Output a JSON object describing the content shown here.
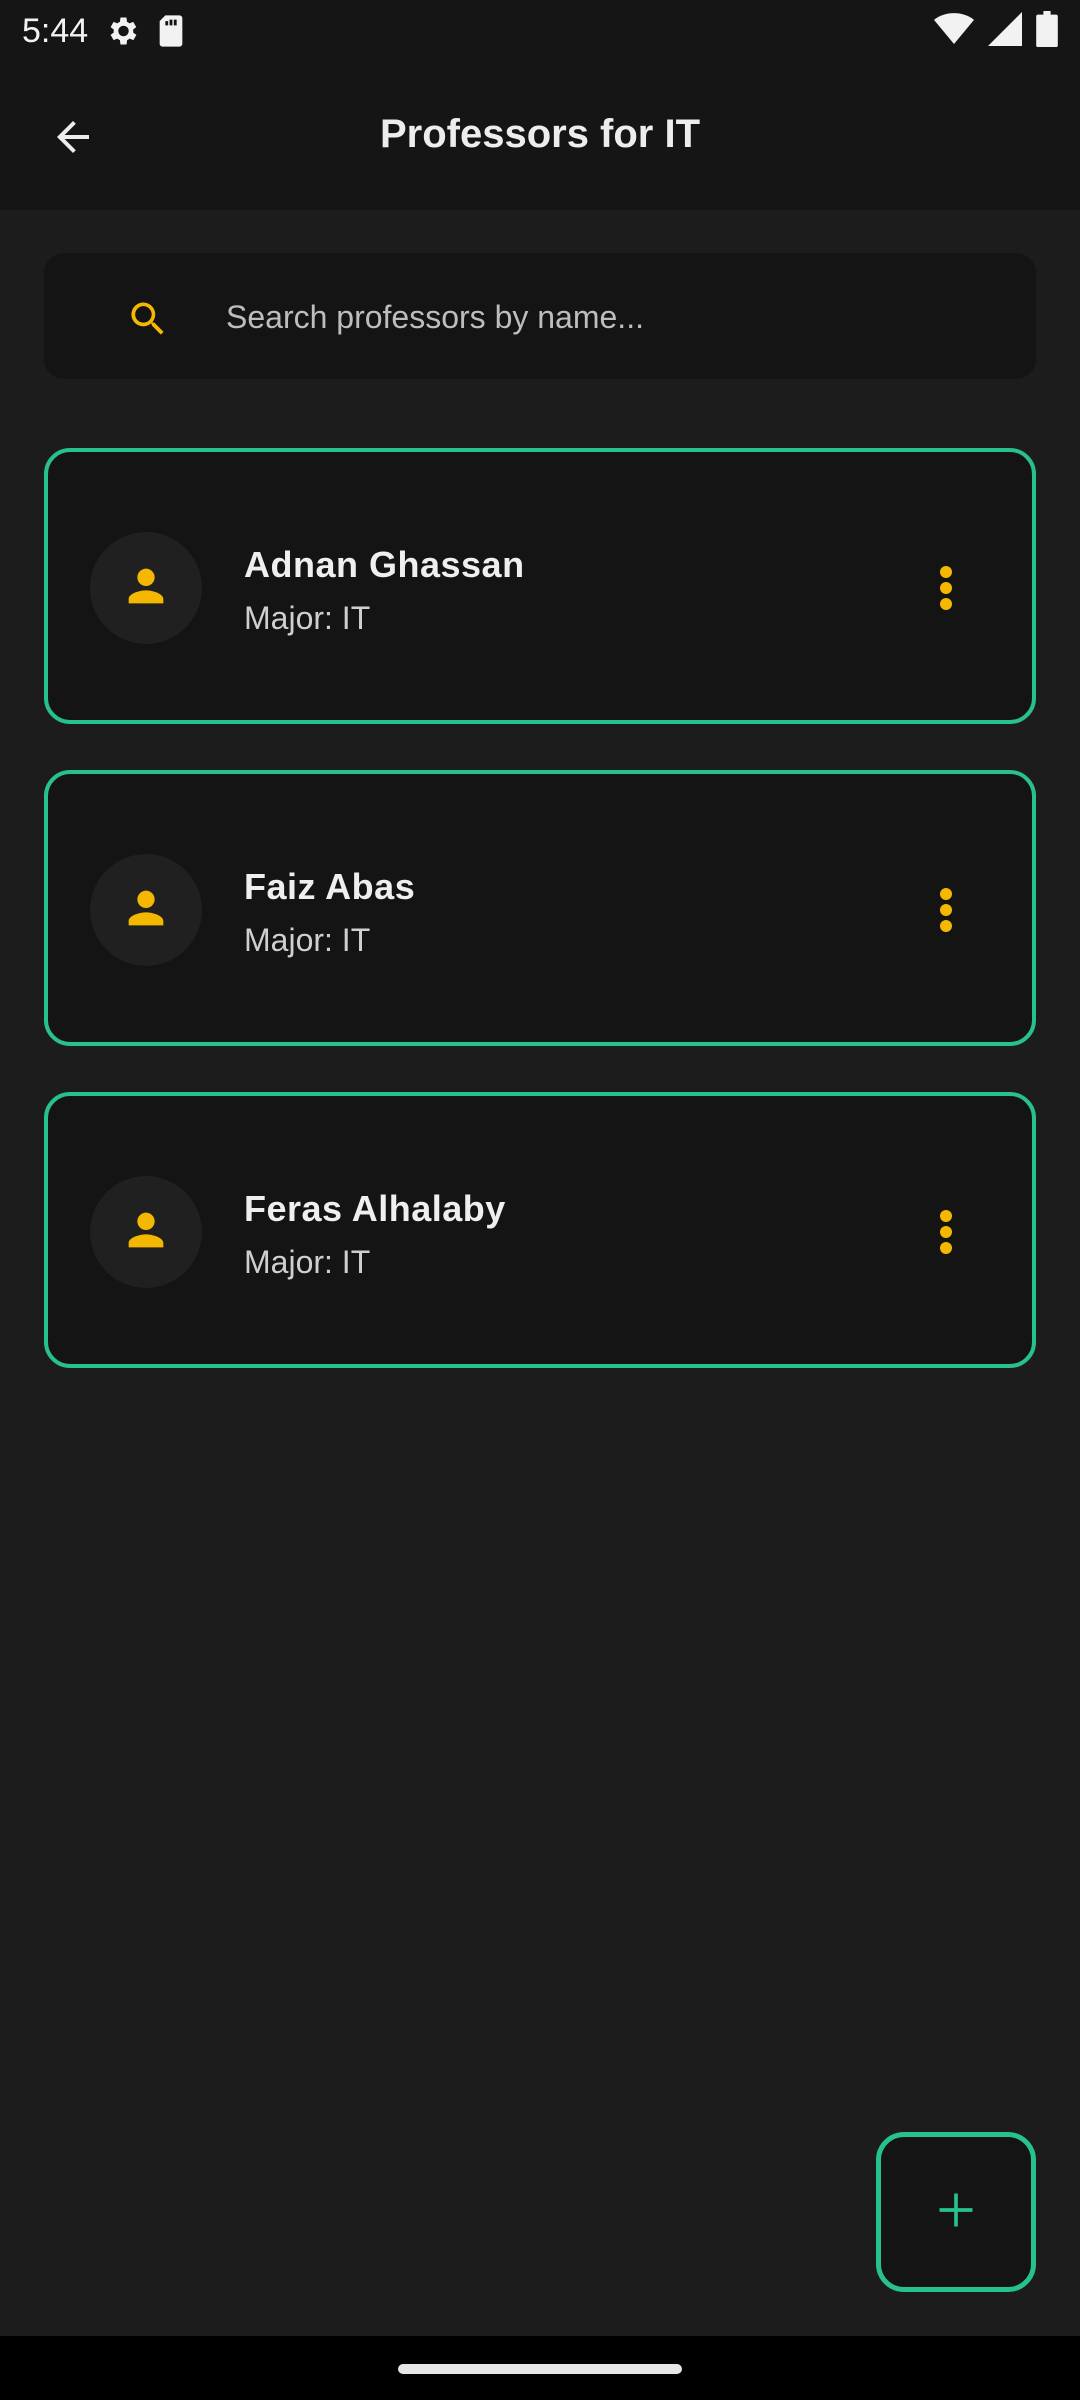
{
  "status_bar": {
    "time": "5:44"
  },
  "app_bar": {
    "title": "Professors for IT"
  },
  "search": {
    "placeholder": "Search professors by name..."
  },
  "professors": [
    {
      "name": "Adnan Ghassan",
      "major": "Major: IT"
    },
    {
      "name": "Faiz Abas",
      "major": "Major: IT"
    },
    {
      "name": "Feras Alhalaby",
      "major": "Major: IT"
    }
  ],
  "colors": {
    "accent": "#27c08f",
    "icon": "#f5b800",
    "background": "#1c1c1c",
    "card": "#141414"
  },
  "icons": {
    "back": "arrow-back-icon",
    "search": "search-icon",
    "avatar": "person-icon",
    "menu": "more-vertical-icon",
    "fab": "plus-icon"
  }
}
